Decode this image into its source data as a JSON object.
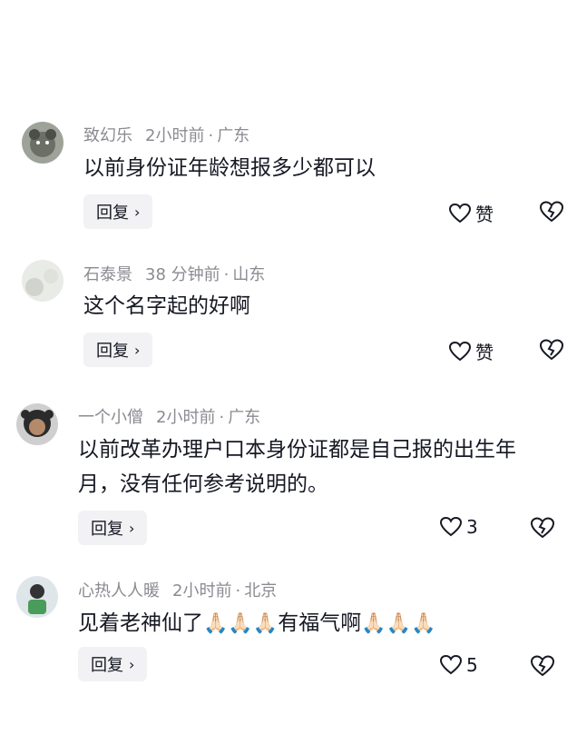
{
  "comments": [
    {
      "name": "致幻乐",
      "time": "2小时前",
      "sep": "·",
      "location": "广东",
      "text": "以前身份证年龄想报多少都可以",
      "reply_label": "回复",
      "like_label": "赞"
    },
    {
      "name": "石泰景",
      "time": "38 分钟前",
      "sep": "·",
      "location": "山东",
      "text": "这个名字起的好啊",
      "reply_label": "回复",
      "like_label": "赞"
    },
    {
      "name": "一个小僧",
      "time": "2小时前",
      "sep": "·",
      "location": "广东",
      "text": "以前改革办理户口本身份证都是自己报的出生年月，没有任何参考说明的。",
      "reply_label": "回复",
      "like_label": "3"
    },
    {
      "name": "心热人人暖",
      "time": "2小时前",
      "sep": "·",
      "location": "北京",
      "text_before": "见着老神仙了",
      "text_mid": "有福气啊",
      "emoji": "🙏🏻🙏🏻🙏🏻",
      "reply_label": "回复",
      "like_label": "5"
    }
  ],
  "colors": {
    "meta": "#8a8b91",
    "text": "#161823",
    "reply_bg": "#f2f2f4"
  },
  "icons": {
    "like": "heart-outline-icon",
    "dislike": "broken-heart-icon",
    "reply_chevron": "chevron-right-icon"
  }
}
